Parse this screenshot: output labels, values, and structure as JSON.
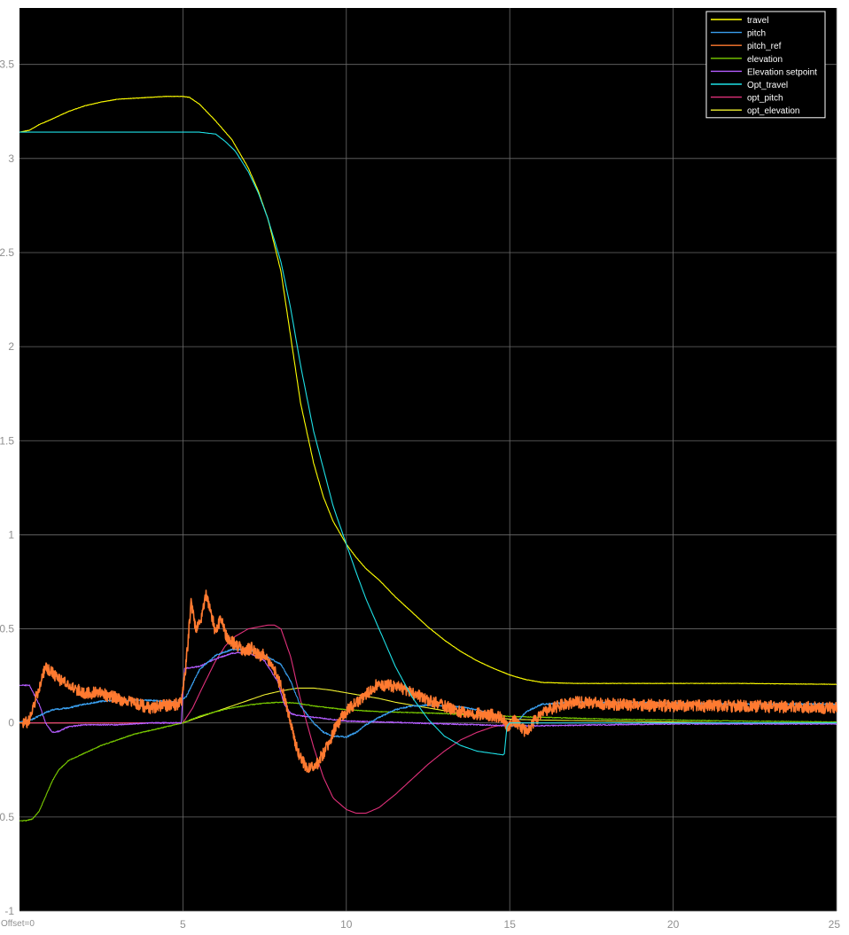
{
  "footer": {
    "offset_text": "Offset=0"
  },
  "colors": {
    "background": "#000000",
    "grid": "#6a6a6a",
    "tick_text": "#8f8f8f"
  },
  "chart_data": {
    "type": "line",
    "xlim": [
      0,
      25
    ],
    "ylim": [
      -1,
      3.8
    ],
    "xticks": [
      5,
      10,
      15,
      20,
      25
    ],
    "xtick_labels": [
      "",
      "5",
      "10",
      "15",
      "20",
      "25"
    ],
    "yticks": [
      -1,
      -0.5,
      0,
      0.5,
      1,
      1.5,
      2,
      2.5,
      3,
      3.5
    ],
    "ytick_labels": [
      "-1",
      "0.5",
      "0",
      "0.5",
      "1",
      "1.5",
      "2",
      "2.5",
      "3",
      "3.5"
    ],
    "grid": true,
    "legend_position": "top-right",
    "series": [
      {
        "name": "travel",
        "color": "#ffff00",
        "noise": 0.001,
        "x": [
          0,
          0.3,
          0.6,
          1,
          1.5,
          2,
          2.5,
          3,
          3.5,
          4,
          4.5,
          5,
          5.2,
          5.5,
          6,
          6.5,
          7,
          7.3,
          7.6,
          8,
          8.3,
          8.6,
          9,
          9.3,
          9.6,
          10,
          10.3,
          10.6,
          11,
          11.5,
          12,
          12.5,
          13,
          13.5,
          14,
          14.5,
          15,
          15.5,
          16,
          17,
          18,
          20,
          22,
          25
        ],
        "y": [
          3.14,
          3.15,
          3.18,
          3.21,
          3.25,
          3.28,
          3.3,
          3.315,
          3.32,
          3.325,
          3.33,
          3.33,
          3.325,
          3.29,
          3.2,
          3.1,
          2.95,
          2.83,
          2.68,
          2.4,
          2.05,
          1.7,
          1.38,
          1.2,
          1.07,
          0.95,
          0.88,
          0.82,
          0.76,
          0.67,
          0.59,
          0.51,
          0.44,
          0.38,
          0.33,
          0.29,
          0.255,
          0.23,
          0.215,
          0.21,
          0.21,
          0.21,
          0.21,
          0.205
        ]
      },
      {
        "name": "pitch",
        "color": "#3aa0f0",
        "noise": 0.004,
        "x": [
          0,
          0.4,
          0.8,
          1,
          1.5,
          2,
          2.5,
          3,
          3.5,
          4,
          4.5,
          4.9,
          5.1,
          5.5,
          6,
          6.5,
          7,
          7.5,
          8,
          8.3,
          8.6,
          9,
          9.3,
          9.6,
          10,
          10.3,
          10.6,
          11,
          11.5,
          12,
          12.5,
          13,
          13.5,
          14,
          14.5,
          14.8,
          15.1,
          15.5,
          16,
          17,
          18,
          20,
          22,
          25
        ],
        "y": [
          0.005,
          0.02,
          0.055,
          0.07,
          0.08,
          0.1,
          0.115,
          0.12,
          0.12,
          0.12,
          0.115,
          0.11,
          0.14,
          0.28,
          0.36,
          0.39,
          0.39,
          0.36,
          0.31,
          0.22,
          0.09,
          0.0,
          -0.05,
          -0.07,
          -0.075,
          -0.05,
          -0.01,
          0.03,
          0.07,
          0.09,
          0.095,
          0.09,
          0.085,
          0.07,
          0.045,
          0.01,
          -0.02,
          0.06,
          0.1,
          0.11,
          0.11,
          0.105,
          0.1,
          0.1
        ]
      },
      {
        "name": "pitch_ref",
        "color": "#ff7a30",
        "noise": 0.032,
        "x": [
          0,
          0.15,
          0.3,
          0.5,
          0.8,
          1.2,
          1.6,
          2,
          2.4,
          2.8,
          3.2,
          3.6,
          4,
          4.4,
          4.8,
          4.95,
          5.1,
          5.25,
          5.4,
          5.55,
          5.7,
          5.85,
          6,
          6.15,
          6.3,
          6.5,
          6.7,
          6.9,
          7.1,
          7.3,
          7.5,
          7.7,
          7.9,
          8.1,
          8.3,
          8.5,
          8.8,
          9.1,
          9.4,
          9.7,
          10,
          10.3,
          10.6,
          10.9,
          11.2,
          11.6,
          12,
          12.5,
          13,
          13.5,
          14,
          14.5,
          14.8,
          14.95,
          15.1,
          15.3,
          15.5,
          15.8,
          16.2,
          16.6,
          17,
          18,
          20,
          22,
          25
        ],
        "y": [
          0.0,
          0.0,
          0.01,
          0.13,
          0.3,
          0.23,
          0.19,
          0.16,
          0.16,
          0.14,
          0.12,
          0.1,
          0.08,
          0.09,
          0.1,
          0.11,
          0.32,
          0.63,
          0.5,
          0.54,
          0.68,
          0.6,
          0.48,
          0.56,
          0.47,
          0.43,
          0.41,
          0.38,
          0.4,
          0.36,
          0.36,
          0.32,
          0.24,
          0.14,
          0.0,
          -0.15,
          -0.24,
          -0.22,
          -0.13,
          -0.01,
          0.06,
          0.11,
          0.15,
          0.2,
          0.2,
          0.19,
          0.16,
          0.12,
          0.09,
          0.06,
          0.05,
          0.04,
          0.02,
          -0.03,
          0.02,
          -0.01,
          -0.05,
          0.02,
          0.07,
          0.1,
          0.11,
          0.1,
          0.09,
          0.09,
          0.08
        ]
      },
      {
        "name": "elevation",
        "color": "#7acc00",
        "noise": 0.002,
        "x": [
          0,
          0.2,
          0.4,
          0.6,
          0.8,
          1,
          1.2,
          1.5,
          2,
          2.5,
          3,
          3.5,
          4,
          4.5,
          5,
          5.5,
          6,
          6.5,
          7,
          7.5,
          8,
          8.5,
          9,
          9.5,
          10,
          11,
          12,
          13,
          14,
          15,
          16,
          18,
          20,
          22,
          25
        ],
        "y": [
          -0.52,
          -0.52,
          -0.51,
          -0.47,
          -0.39,
          -0.31,
          -0.25,
          -0.2,
          -0.16,
          -0.12,
          -0.09,
          -0.06,
          -0.04,
          -0.02,
          0.0,
          0.035,
          0.06,
          0.08,
          0.095,
          0.105,
          0.11,
          0.105,
          0.09,
          0.08,
          0.07,
          0.06,
          0.055,
          0.05,
          0.04,
          0.035,
          0.03,
          0.02,
          0.015,
          0.01,
          0.005
        ]
      },
      {
        "name": "Elevation setpoint",
        "color": "#b45cff",
        "noise": 0.003,
        "x": [
          0,
          0.3,
          0.6,
          0.8,
          1,
          1.2,
          1.5,
          2,
          2.5,
          3,
          3.5,
          4,
          4.5,
          4.95,
          5.05,
          5.5,
          6,
          6.5,
          7,
          7.5,
          7.9,
          8.1,
          8.3,
          8.5,
          9,
          9.5,
          10,
          11,
          12,
          13,
          14,
          15,
          16,
          18,
          20,
          22,
          25
        ],
        "y": [
          0.2,
          0.2,
          0.1,
          0.0,
          -0.05,
          -0.045,
          -0.02,
          -0.01,
          -0.01,
          -0.01,
          -0.005,
          0.0,
          0.0,
          0.0,
          0.29,
          0.3,
          0.34,
          0.37,
          0.375,
          0.33,
          0.22,
          0.1,
          0.05,
          0.04,
          0.03,
          0.02,
          0.01,
          0.005,
          0.0,
          -0.005,
          -0.01,
          -0.015,
          -0.015,
          -0.01,
          -0.005,
          -0.005,
          -0.005
        ]
      },
      {
        "name": "Opt_travel",
        "color": "#1ee0e6",
        "noise": 0,
        "x": [
          0,
          2,
          4,
          5,
          5.5,
          6,
          6.3,
          6.6,
          7,
          7.3,
          7.6,
          8,
          8.3,
          8.6,
          9,
          9.3,
          9.6,
          10,
          10.3,
          10.6,
          11,
          11.5,
          12,
          12.5,
          13,
          13.5,
          14,
          14.4,
          14.8,
          14.85,
          14.9,
          15,
          16,
          18,
          20,
          22,
          25
        ],
        "y": [
          3.14,
          3.14,
          3.14,
          3.14,
          3.14,
          3.13,
          3.09,
          3.04,
          2.93,
          2.82,
          2.68,
          2.45,
          2.2,
          1.9,
          1.55,
          1.35,
          1.15,
          0.95,
          0.8,
          0.66,
          0.5,
          0.3,
          0.14,
          0.02,
          -0.07,
          -0.12,
          -0.15,
          -0.16,
          -0.17,
          -0.16,
          -0.02,
          0.0,
          0.0,
          0.0,
          0.0,
          0.0,
          0.0
        ]
      },
      {
        "name": "opt_pitch",
        "color": "#e0307a",
        "noise": 0,
        "x": [
          0,
          2,
          4,
          5,
          5.3,
          5.6,
          6,
          6.3,
          6.6,
          7,
          7.3,
          7.6,
          7.8,
          8,
          8.3,
          8.6,
          9,
          9.3,
          9.6,
          10,
          10.3,
          10.6,
          11,
          11.5,
          12,
          12.5,
          13,
          13.5,
          14,
          14.5,
          14.8,
          15,
          16,
          18,
          20,
          22,
          25
        ],
        "y": [
          0,
          0,
          0,
          0,
          0.08,
          0.19,
          0.33,
          0.41,
          0.46,
          0.5,
          0.51,
          0.52,
          0.52,
          0.5,
          0.35,
          0.12,
          -0.13,
          -0.29,
          -0.4,
          -0.46,
          -0.48,
          -0.48,
          -0.45,
          -0.38,
          -0.3,
          -0.22,
          -0.15,
          -0.09,
          -0.05,
          -0.02,
          -0.01,
          0,
          0,
          0,
          0,
          0,
          0
        ]
      },
      {
        "name": "opt_elevation",
        "color": "#f0f030",
        "noise": 0,
        "x": [
          0,
          2,
          4,
          5,
          5.5,
          6,
          6.5,
          7,
          7.5,
          8,
          8.5,
          9,
          9.5,
          10,
          10.5,
          11,
          11.5,
          12,
          12.5,
          13,
          13.5,
          14,
          14.5,
          15,
          16,
          18,
          20,
          22,
          25
        ],
        "y": [
          0,
          0,
          0,
          0,
          0.03,
          0.06,
          0.09,
          0.12,
          0.15,
          0.17,
          0.185,
          0.185,
          0.175,
          0.16,
          0.145,
          0.13,
          0.11,
          0.095,
          0.08,
          0.065,
          0.05,
          0.04,
          0.03,
          0.02,
          0.015,
          0.01,
          0.005,
          0.0,
          0.0
        ]
      }
    ]
  }
}
